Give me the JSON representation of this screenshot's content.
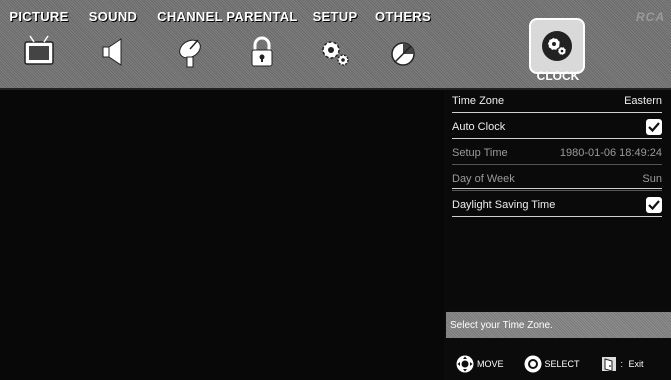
{
  "menu": {
    "tabs": [
      {
        "label": "PICTURE",
        "icon": "tv-icon"
      },
      {
        "label": "SOUND",
        "icon": "speaker-icon"
      },
      {
        "label": "CHANNEL",
        "icon": "satellite-dish-icon"
      },
      {
        "label": "PARENTAL",
        "icon": "lock-icon"
      },
      {
        "label": "SETUP",
        "icon": "gears-icon"
      },
      {
        "label": "OTHERS",
        "icon": "pie-chart-icon"
      }
    ],
    "brand": "RCA",
    "selected_submenu": {
      "label": "CLOCK",
      "icon": "clock-gears-icon"
    }
  },
  "clock_settings": {
    "rows": [
      {
        "label": "Time Zone",
        "value": "Eastern"
      },
      {
        "label": "Auto Clock",
        "checked": true
      },
      {
        "label": "Setup Time",
        "value": "1980-01-06 18:49:24"
      },
      {
        "label": "Day of Week",
        "value": "Sun"
      },
      {
        "label": "Daylight Saving Time",
        "checked": true
      }
    ]
  },
  "hint": "Select your Time Zone.",
  "footer": {
    "move": "MOVE",
    "select": "SELECT",
    "exit": "Exit"
  },
  "colors": {
    "menu_bg": "#747474",
    "screen_bg": "#0b0b0b",
    "text": "#ffffff",
    "dim_text": "#9a9a9a"
  }
}
